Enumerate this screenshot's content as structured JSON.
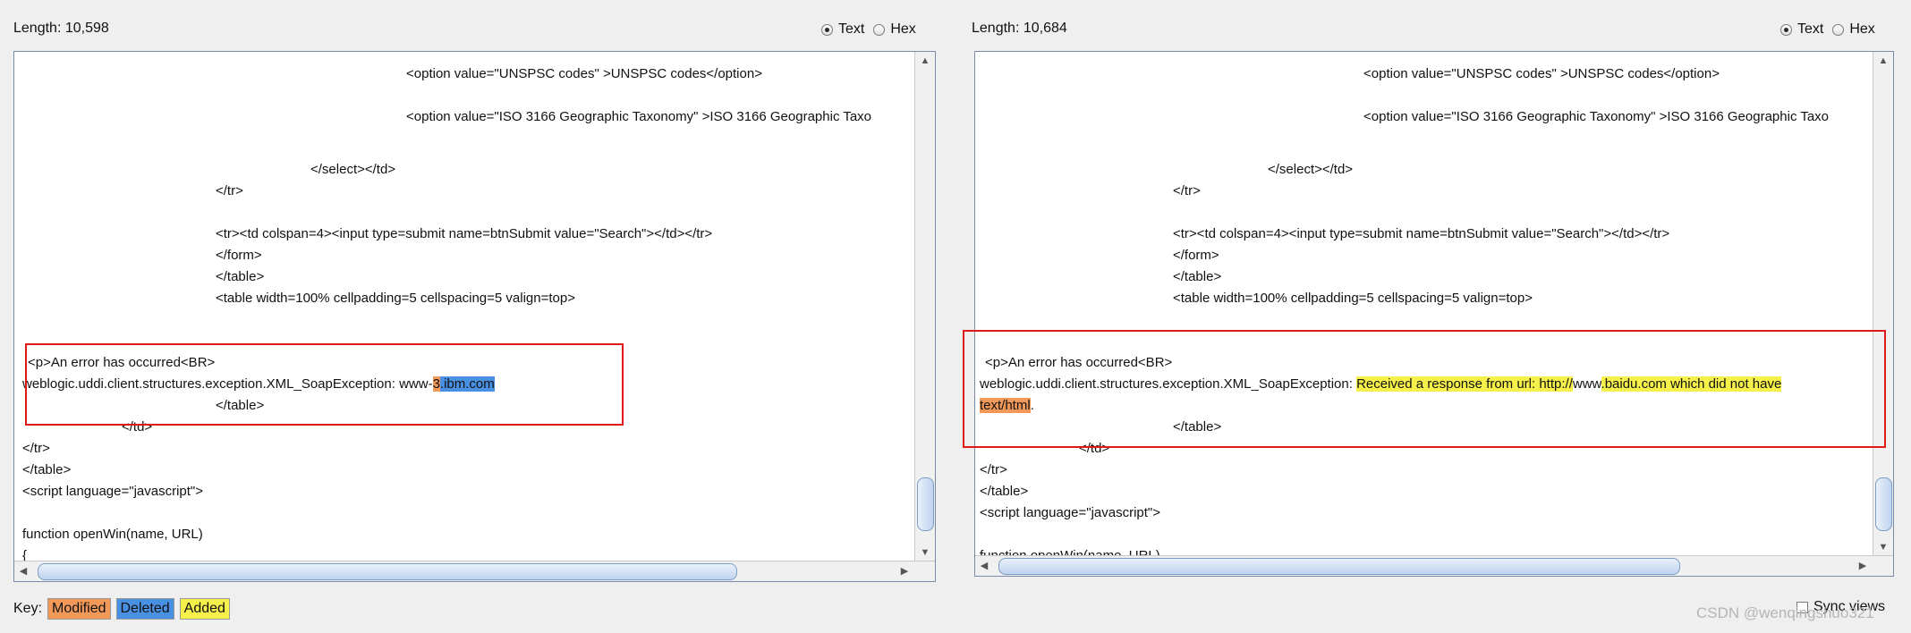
{
  "left_pane": {
    "length_label": "Length: 10,598",
    "mode_options": [
      "Text",
      "Hex"
    ],
    "selected_mode": "Text",
    "lines": [
      {
        "text": "<option value=\"UNSPSC codes\" >UNSPSC codes</option>"
      },
      {
        "text": "<option value=\"ISO 3166 Geographic Taxonomy\" >ISO 3166 Geographic Taxo"
      },
      {
        "text": "</select></td>"
      },
      {
        "text": "</tr>"
      },
      {
        "text": "<tr><td colspan=4><input type=submit name=btnSubmit value=\"Search\"></td></tr>"
      },
      {
        "text": "</form>"
      },
      {
        "text": "</table>"
      },
      {
        "text": "<table width=100% cellpadding=5 cellspacing=5 valign=top>"
      },
      {
        "text": "<p>An error has occurred<BR>"
      },
      {
        "prefix": "weblogic.uddi.client.structures.exception.XML_SoapException: www-",
        "modified": "3",
        "deleted": ".ibm.com"
      },
      {
        "text": "</table>"
      },
      {
        "text": "</td>"
      },
      {
        "text": "</tr>"
      },
      {
        "text": "</table>"
      },
      {
        "text": "<script language=\"javascript\">"
      },
      {
        "text": "function openWin(name, URL)"
      },
      {
        "text": "{"
      }
    ]
  },
  "right_pane": {
    "length_label": "Length: 10,684",
    "mode_options": [
      "Text",
      "Hex"
    ],
    "selected_mode": "Text",
    "lines": [
      {
        "text": "<option value=\"UNSPSC codes\" >UNSPSC codes</option>"
      },
      {
        "text": "<option value=\"ISO 3166 Geographic Taxonomy\" >ISO 3166 Geographic Taxo"
      },
      {
        "text": "</select></td>"
      },
      {
        "text": "</tr>"
      },
      {
        "text": "<tr><td colspan=4><input type=submit name=btnSubmit value=\"Search\"></td></tr>"
      },
      {
        "text": "</form>"
      },
      {
        "text": "</table>"
      },
      {
        "text": "<table width=100% cellpadding=5 cellspacing=5 valign=top>"
      },
      {
        "text": "<p>An error has occurred<BR>"
      },
      {
        "prefix": "weblogic.uddi.client.structures.exception.XML_SoapException: ",
        "added1": "Received a response from url: http://",
        "middle": "www",
        "added2": ".baidu.com which did not have"
      },
      {
        "modified": "text/html",
        "suffix": "."
      },
      {
        "text": "</table>"
      },
      {
        "text": "</td>"
      },
      {
        "text": "</tr>"
      },
      {
        "text": "</table>"
      },
      {
        "text": "<script language=\"javascript\">"
      },
      {
        "text": "function openWin(name, URL)"
      }
    ]
  },
  "key": {
    "label": "Key:",
    "modified": "Modified",
    "deleted": "Deleted",
    "added": "Added"
  },
  "sync_views": "Sync views",
  "watermark": "CSDN @wenqingshuo321",
  "colors": {
    "modified": "#f2995a",
    "deleted": "#4a90e2",
    "added": "#f6f04a",
    "highlight_box": "#e01818"
  }
}
